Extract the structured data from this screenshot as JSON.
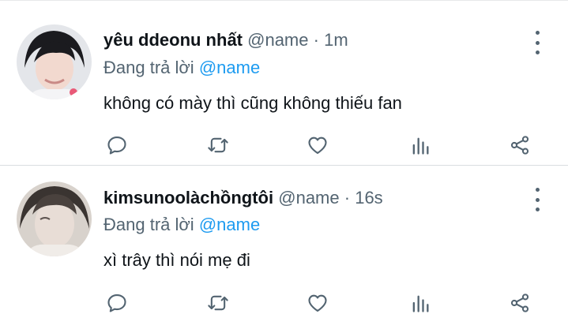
{
  "tweets": [
    {
      "display_name": "yêu ddeonu nhất",
      "handle": "@name",
      "separator": "·",
      "time": "1m",
      "reply_prefix": "Đang trả lời",
      "reply_to": "@name",
      "text": "không có mày thì cũng không thiếu fan"
    },
    {
      "display_name": "kimsunoolàchồngtôi",
      "handle": "@name",
      "separator": "·",
      "time": "16s",
      "reply_prefix": "Đang trả lời",
      "reply_to": "@name",
      "text": "xì trây thì nói mẹ đi"
    }
  ],
  "icons": [
    "avatar",
    "more-icon",
    "reply-icon",
    "retweet-icon",
    "like-icon",
    "stats-icon",
    "share-icon"
  ],
  "colors": {
    "accent": "#1d9bf0",
    "secondary_text": "#536471",
    "primary_text": "#0f1419"
  }
}
